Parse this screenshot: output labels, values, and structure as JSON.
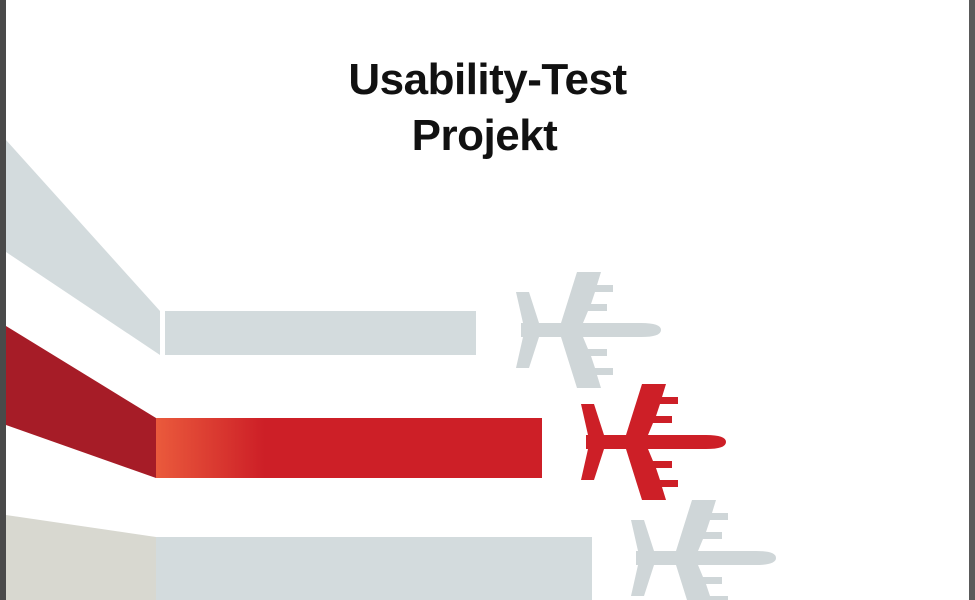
{
  "document": {
    "title_line1": "Usability-Test",
    "title_line2": "Projekt"
  },
  "colors": {
    "gray_band": "#d3dbdd",
    "red_band": "#cd1f27",
    "dark_red": "#a61c27",
    "orange_red": "#ea5a3c",
    "beige_band": "#d8d8d0",
    "gray_plane": "#cfd6d8",
    "red_plane": "#cd1f27"
  },
  "icons": [
    "airplane-icon",
    "airplane-icon",
    "airplane-icon"
  ]
}
